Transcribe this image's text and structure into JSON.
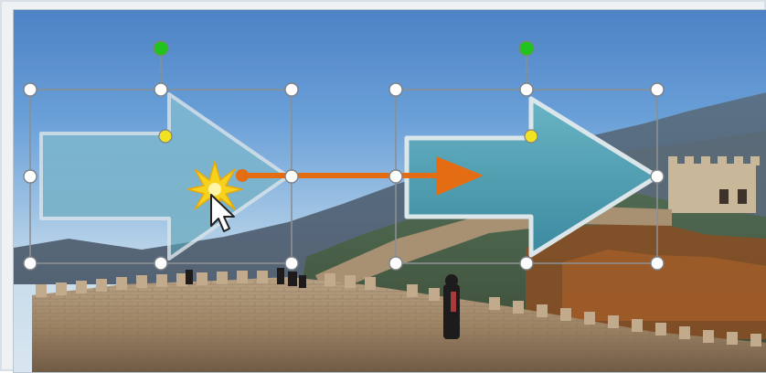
{
  "scene": {
    "description_icon": "photo-background",
    "colors": {
      "sky_top": "#4d82c5",
      "sky_bottom": "#d9e6ef",
      "arrow_fill": "#4f9db0",
      "arrow_outline": "#d9e4ea",
      "motion_path": "#e46d13",
      "handle_fill": "#ffffff",
      "rotate_handle": "#22c21f",
      "adjust_handle": "#f2e322"
    }
  },
  "icons": {
    "cursor": "arrow-cursor-icon",
    "burst": "click-burst-icon"
  }
}
